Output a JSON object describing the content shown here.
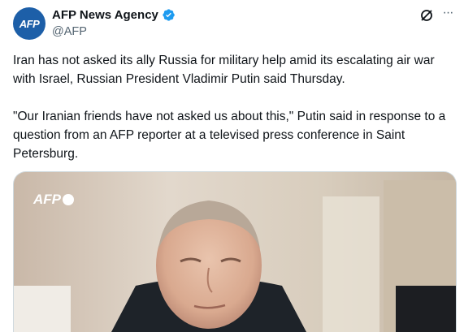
{
  "author": {
    "avatar_text": "AFP",
    "display_name": "AFP News Agency",
    "handle": "@AFP",
    "avatar_color": "#1d5fa8",
    "verified_color": "#1d9bf0"
  },
  "actions": {
    "grok_icon": "grok-icon",
    "more_icon": "more-icon"
  },
  "tweet": {
    "paragraph_1": "Iran has not asked its ally Russia for military help amid its escalating air war with Israel, Russian President Vladimir Putin said Thursday.",
    "paragraph_2": "\"Our Iranian friends have not asked us about this,\" Putin said in response to a question from an AFP reporter at a televised press conference in Saint Petersburg."
  },
  "media": {
    "watermark": "AFP"
  }
}
